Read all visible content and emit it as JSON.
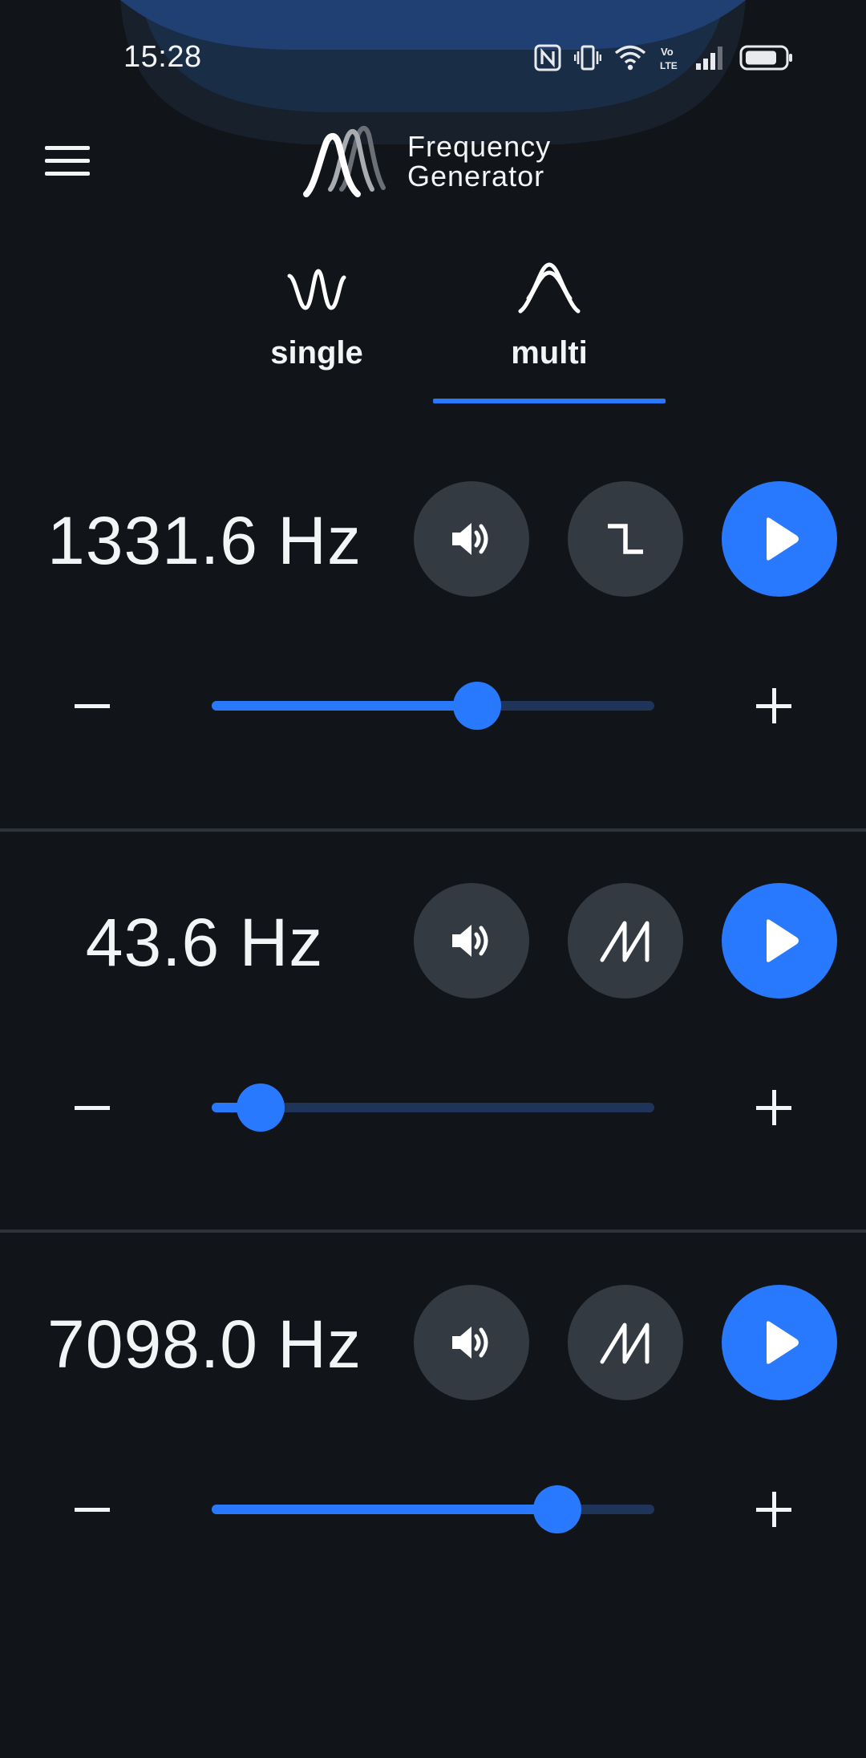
{
  "status_bar": {
    "time": "15:28",
    "icons": [
      "nfc-icon",
      "vibrate-icon",
      "wifi-icon",
      "volte-icon",
      "signal-icon",
      "battery-icon"
    ]
  },
  "header": {
    "logo_line1": "Frequency",
    "logo_line2": "Generator",
    "menu_icon": "hamburger-menu-icon"
  },
  "tabs": [
    {
      "label": "single",
      "icon": "single-wave-icon",
      "active": false
    },
    {
      "label": "multi",
      "icon": "multi-wave-icon",
      "active": true
    }
  ],
  "generators": [
    {
      "frequency": "1331.6 Hz",
      "waveform_icon": "square-wave-icon",
      "slider_level": 0.6,
      "volume_icon": "volume-icon",
      "play_icon": "play-icon"
    },
    {
      "frequency": "43.6 Hz",
      "waveform_icon": "sawtooth-wave-icon",
      "slider_level": 0.11,
      "volume_icon": "volume-icon",
      "play_icon": "play-icon"
    },
    {
      "frequency": "7098.0 Hz",
      "waveform_icon": "sawtooth-wave-icon",
      "slider_level": 0.78,
      "volume_icon": "volume-icon",
      "play_icon": "play-icon"
    }
  ],
  "colors": {
    "background": "#111519",
    "accent": "#2979ff",
    "button_gray": "#333a41",
    "slider_track": "#1f3458"
  }
}
